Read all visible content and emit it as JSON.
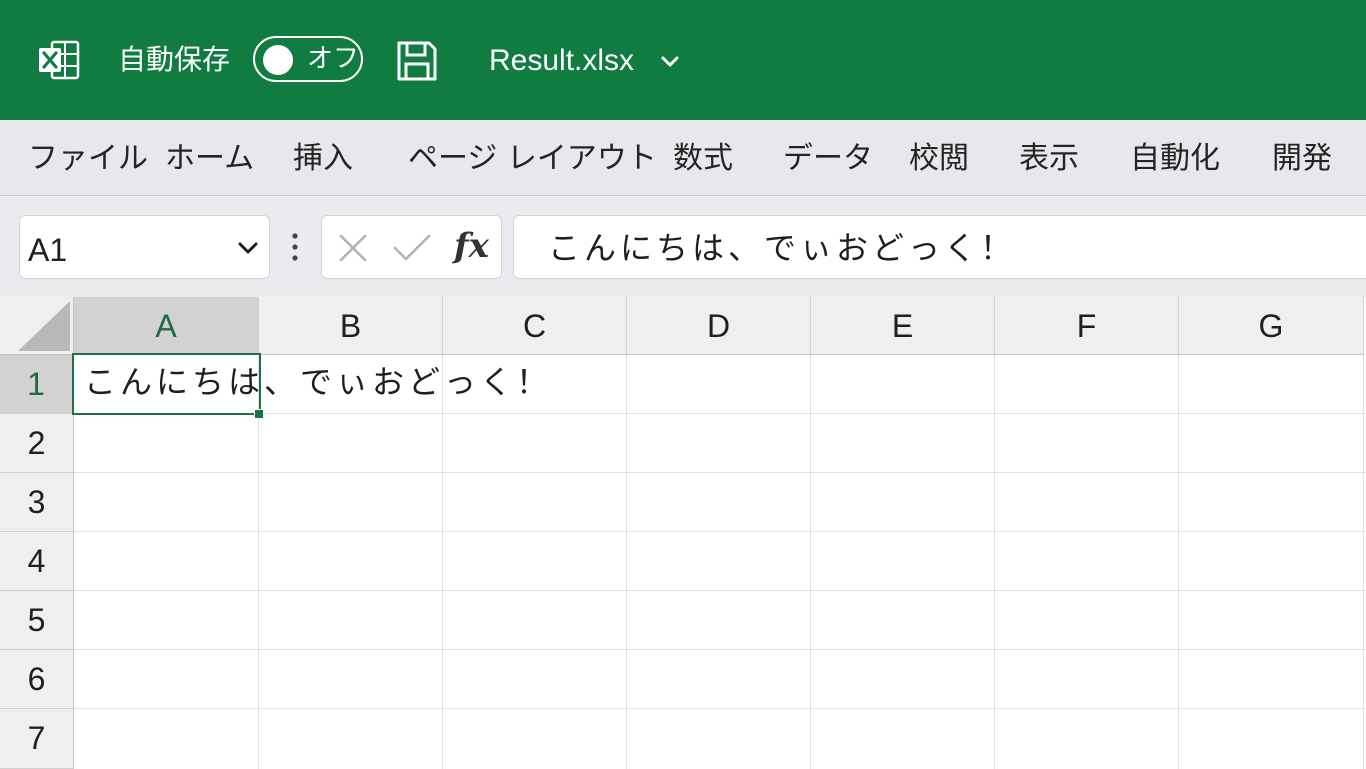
{
  "titlebar": {
    "app_icon": "excel-icon",
    "autosave_label": "自動保存",
    "autosave_toggle": "オフ",
    "save_icon": "save-icon",
    "filename": "Result.xlsx",
    "colors": {
      "accent": "#107c41",
      "text": "#ffffff"
    }
  },
  "ribbon": {
    "tabs": [
      {
        "label": "ファイル"
      },
      {
        "label": "ホーム"
      },
      {
        "label": "挿入"
      },
      {
        "label": "ページ レイアウト"
      },
      {
        "label": "数式"
      },
      {
        "label": "データ"
      },
      {
        "label": "校閲"
      },
      {
        "label": "表示"
      },
      {
        "label": "自動化"
      },
      {
        "label": "開発"
      }
    ]
  },
  "formula": {
    "name_box": "A1",
    "fx_label": "fx",
    "content": "こんにちは、でぃおどっく！"
  },
  "grid": {
    "columns": [
      "A",
      "B",
      "C",
      "D",
      "E",
      "F",
      "G"
    ],
    "rows": [
      "1",
      "2",
      "3",
      "4",
      "5",
      "6",
      "7"
    ],
    "selected_cell": "A1",
    "cells": {
      "A1": "こんにちは、でぃおどっく！"
    },
    "selection_color": "#1e7145"
  }
}
